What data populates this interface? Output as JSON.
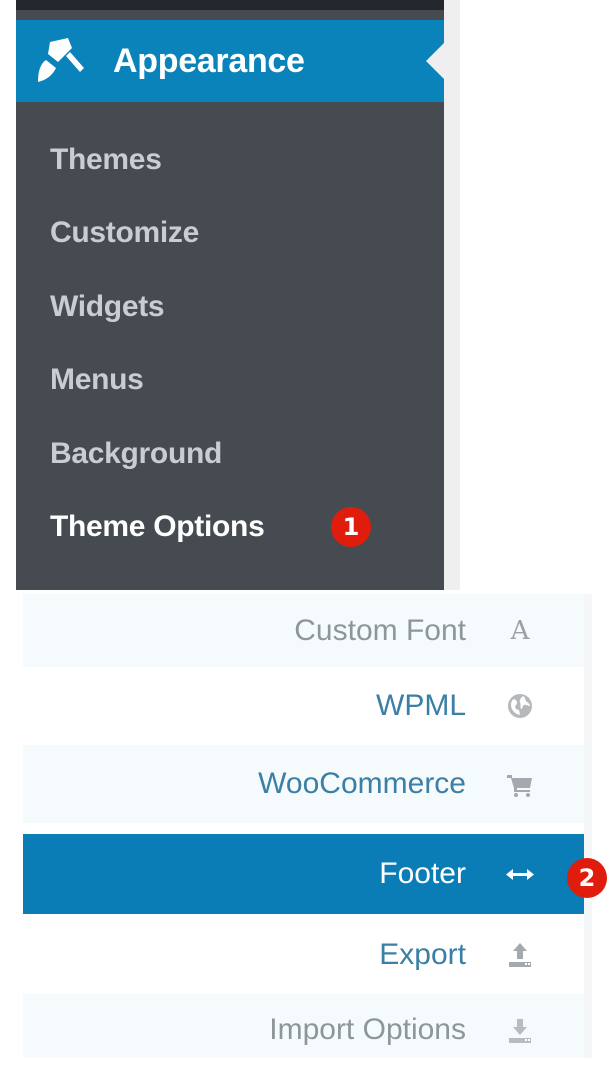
{
  "sidebar": {
    "section": {
      "label": "Appearance",
      "icon": "paintbrush-icon"
    },
    "items": [
      {
        "label": "Themes"
      },
      {
        "label": "Customize"
      },
      {
        "label": "Widgets"
      },
      {
        "label": "Menus"
      },
      {
        "label": "Background"
      },
      {
        "label": "Theme Options",
        "active": true
      }
    ],
    "badge": "1"
  },
  "options_menu": {
    "items": [
      {
        "label": "Custom Font",
        "icon": "font-icon"
      },
      {
        "label": "WPML",
        "icon": "globe-icon"
      },
      {
        "label": "WooCommerce",
        "icon": "cart-icon"
      },
      {
        "label": "Footer",
        "icon": "horizontal-arrows-icon",
        "active": true
      },
      {
        "label": "Export",
        "icon": "upload-icon"
      },
      {
        "label": "Import Options",
        "icon": "download-icon"
      }
    ],
    "badge": "2"
  },
  "colors": {
    "admin_bg": "#464b51",
    "accent_blue": "#0a82ba",
    "badge_red": "#e01c0c"
  }
}
